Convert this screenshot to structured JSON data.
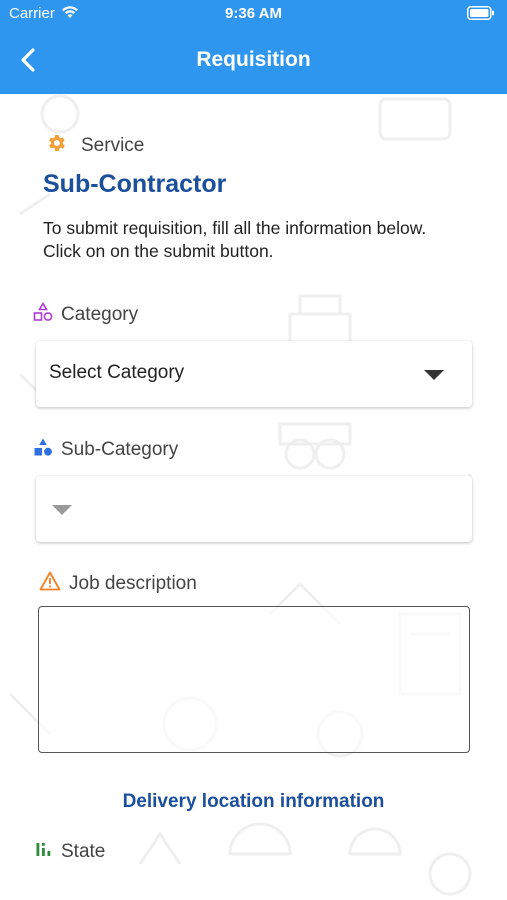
{
  "status_bar": {
    "carrier": "Carrier",
    "time": "9:36 AM"
  },
  "nav": {
    "title": "Requisition"
  },
  "service": {
    "label": "Service",
    "name": "Sub-Contractor",
    "instructions": "To submit requisition, fill all the information below. Click on on the submit button."
  },
  "form": {
    "category": {
      "label": "Category",
      "selected": "Select Category"
    },
    "sub_category": {
      "label": "Sub-Category",
      "selected": ""
    },
    "job_description": {
      "label": "Job description",
      "value": ""
    },
    "delivery_heading": "Delivery location information",
    "state": {
      "label": "State"
    }
  },
  "colors": {
    "header": "#2f96ef",
    "title_blue": "#1c4f9c",
    "gear_orange": "#f2a13a",
    "category_purple": "#b03ad6",
    "subcategory_blue": "#2f6fe0",
    "warning_orange": "#f08020",
    "state_green": "#2e8b3a"
  },
  "icons": {
    "back": "chevron-left-icon",
    "service": "gear-icon",
    "category": "shapes-outline-icon",
    "sub_category": "shapes-filled-icon",
    "job_description": "warning-triangle-icon",
    "state": "bar-chart-icon"
  }
}
